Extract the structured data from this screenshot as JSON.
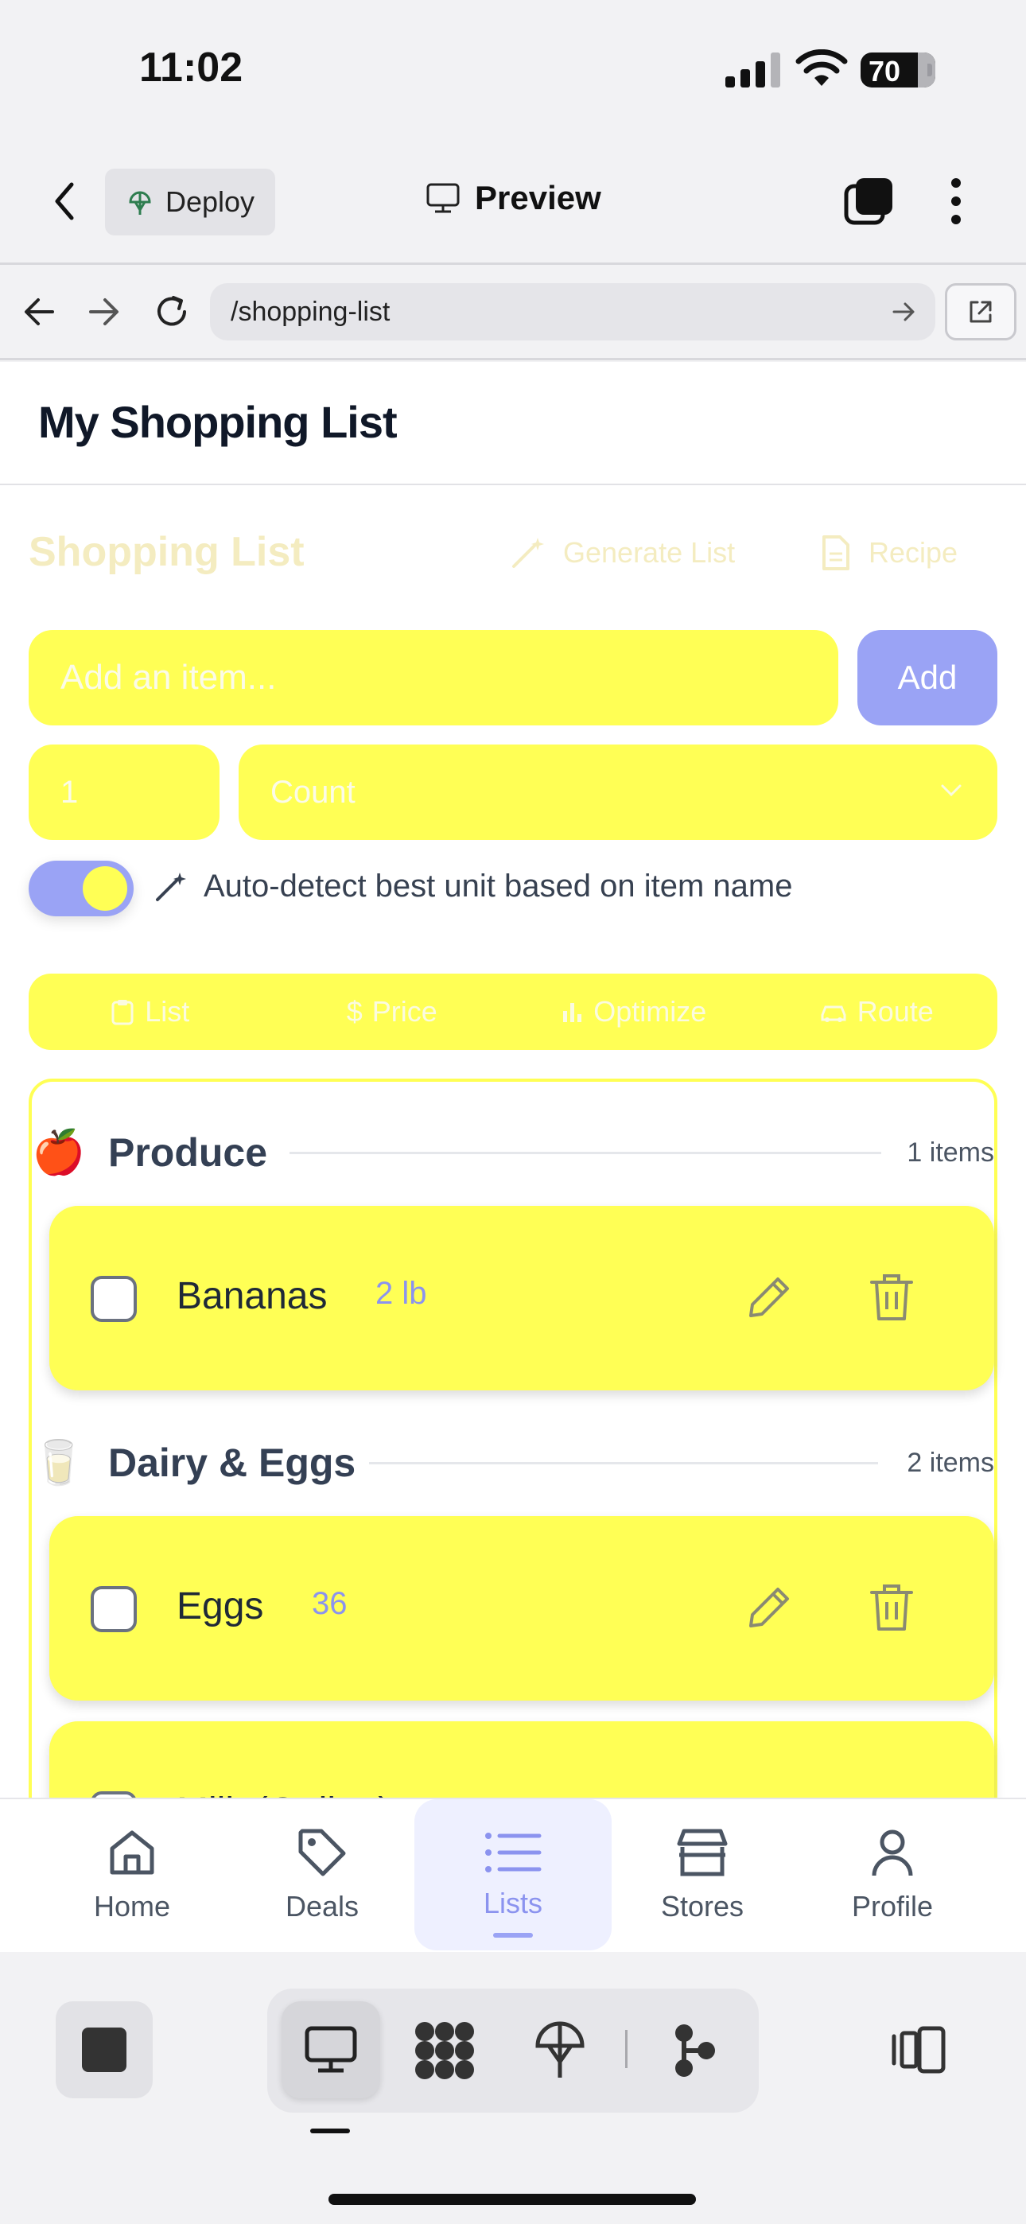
{
  "status_bar": {
    "time": "11:02",
    "battery": "70"
  },
  "toolbar": {
    "deploy_label": "Deploy",
    "preview_label": "Preview"
  },
  "browser": {
    "url": "/shopping-list"
  },
  "page": {
    "title": "My Shopping List",
    "section_title": "Shopping List",
    "generate_label": "Generate List",
    "recipe_label": "Recipe",
    "add_placeholder": "Add an item...",
    "add_button": "Add",
    "quantity_value": "1",
    "unit_value": "Count",
    "auto_detect_label": "Auto-detect best unit based on item name",
    "auto_detect_enabled": true,
    "tabs": [
      {
        "label": "List",
        "icon": "list-icon"
      },
      {
        "label": "Price",
        "icon": "dollar-icon"
      },
      {
        "label": "Optimize",
        "icon": "bar-chart-icon"
      },
      {
        "label": "Route",
        "icon": "car-icon"
      }
    ],
    "categories": [
      {
        "emoji": "🍎",
        "name": "Produce",
        "count": "1 items",
        "items": [
          {
            "name": "Bananas",
            "qty": "2 lb"
          }
        ]
      },
      {
        "emoji": "🥛",
        "name": "Dairy & Eggs",
        "count": "2 items",
        "items": [
          {
            "name": "Eggs",
            "qty": "36"
          },
          {
            "name": "Milk (Gallon)",
            "qty": ""
          }
        ]
      }
    ]
  },
  "bottom_nav": [
    {
      "label": "Home",
      "icon": "home-icon",
      "active": false
    },
    {
      "label": "Deals",
      "icon": "tag-icon",
      "active": false
    },
    {
      "label": "Lists",
      "icon": "list-icon",
      "active": true
    },
    {
      "label": "Stores",
      "icon": "store-icon",
      "active": false
    },
    {
      "label": "Profile",
      "icon": "user-icon",
      "active": false
    }
  ],
  "colors": {
    "accent": "#9aa3f5",
    "highlight": "#ffff55",
    "text_dark": "#101828"
  }
}
